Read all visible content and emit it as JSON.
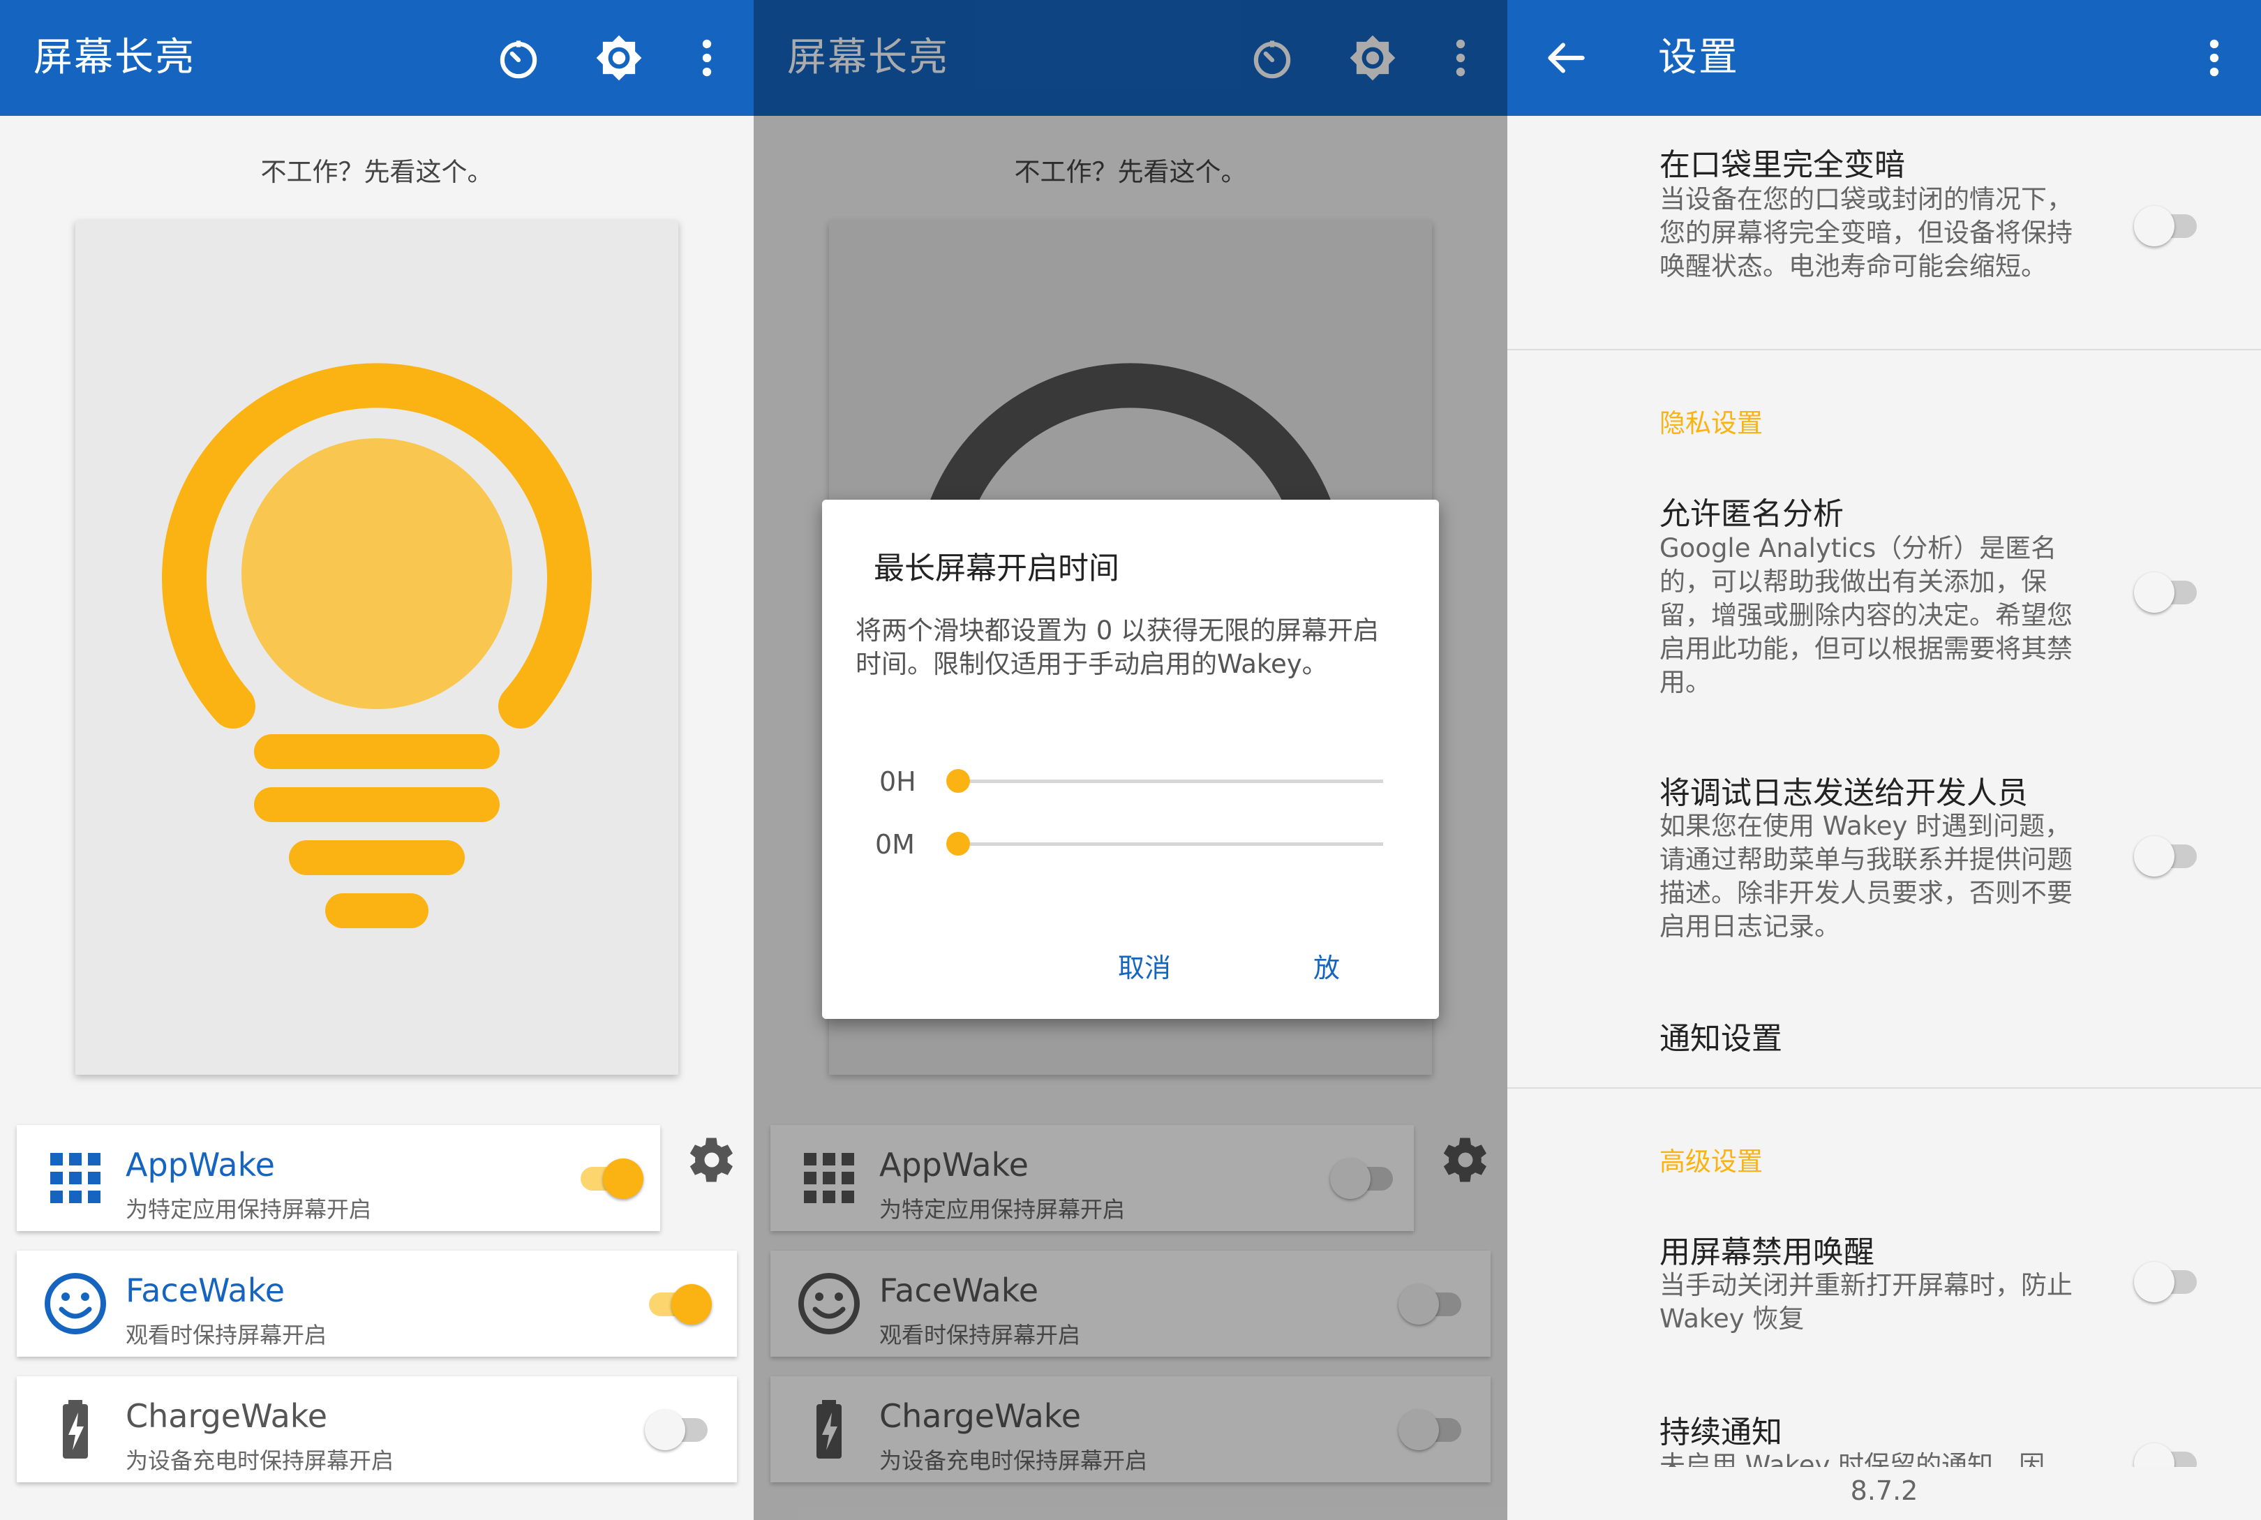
{
  "colors": {
    "primary": "#1565c0",
    "accent": "#fbb314",
    "bulb_inner": "#f9c74f"
  },
  "main": {
    "title": "屏幕长亮",
    "hint": "不工作？先看这个。",
    "features": [
      {
        "name": "AppWake",
        "desc": "为特定应用保持屏幕开启",
        "icon": "apps-grid-icon",
        "enabled": true
      },
      {
        "name": "FaceWake",
        "desc": "观看时保持屏幕开启",
        "icon": "smiley-face-icon",
        "enabled": true
      },
      {
        "name": "ChargeWake",
        "desc": "为设备充电时保持屏幕开启",
        "icon": "battery-charging-icon",
        "enabled": false
      }
    ]
  },
  "dialog_panel": {
    "title": "屏幕长亮",
    "hint": "不工作？先看这个。",
    "features": [
      {
        "name": "AppWake",
        "desc": "为特定应用保持屏幕开启",
        "enabled": false
      },
      {
        "name": "FaceWake",
        "desc": "观看时保持屏幕开启",
        "enabled": false
      },
      {
        "name": "ChargeWake",
        "desc": "为设备充电时保持屏幕开启",
        "enabled": false
      }
    ],
    "dialog": {
      "title": "最长屏幕开启时间",
      "body": "将两个滑块都设置为 0 以获得无限的屏幕开启时间。限制仅适用于手动启用的Wakey。",
      "hours_label": "0H",
      "minutes_label": "0M",
      "hours_value": 0,
      "minutes_value": 0,
      "cancel": "取消",
      "ok": "放"
    }
  },
  "settings": {
    "title": "设置",
    "items": [
      {
        "title": "在口袋里完全变暗",
        "desc": "当设备在您的口袋或封闭的情况下，您的屏幕将完全变暗，但设备将保持唤醒状态。电池寿命可能会缩短。",
        "enabled": false
      },
      {
        "category": "隐私设置"
      },
      {
        "title": "允许匿名分析",
        "desc": "Google Analytics（分析）是匿名的，可以帮助我做出有关添加，保留，增强或删除内容的决定。希望您启用此功能，但可以根据需要将其禁用。",
        "enabled": false
      },
      {
        "title": "将调试日志发送给开发人员",
        "desc": "如果您在使用 Wakey 时遇到问题，请通过帮助菜单与我联系并提供问题描述。除非开发人员要求，否则不要启用日志记录。",
        "enabled": false
      },
      {
        "title": "通知设置"
      },
      {
        "category": "高级设置"
      },
      {
        "title": "用屏幕禁用唤醒",
        "desc": "当手动关闭并重新打开屏幕时，防止 Wakey 恢复",
        "enabled": false
      },
      {
        "title": "持续通知",
        "desc": "未启用 Wakey 时保留的通知，因",
        "enabled": false
      }
    ],
    "version": "8.7.2"
  }
}
